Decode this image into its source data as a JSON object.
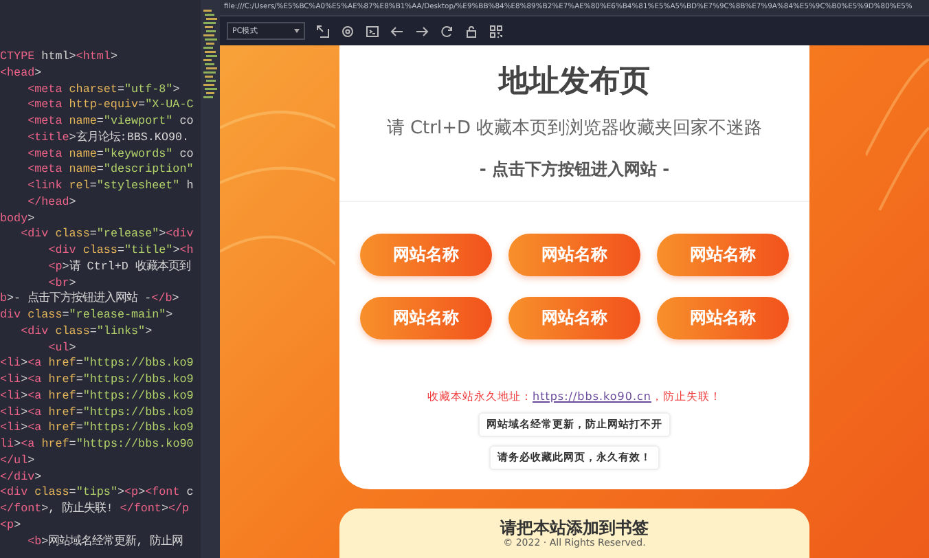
{
  "code_editor": {
    "lines": [
      "CTYPE html><html>",
      "<head>",
      "    <meta charset=\"utf-8\">",
      "    <meta http-equiv=\"X-UA-C",
      "    <meta name=\"viewport\" co",
      "    <title>玄月论坛:BBS.KO90.",
      "    <meta name=\"keywords\" co",
      "    <meta name=\"description\"",
      "    <link rel=\"stylesheet\" h",
      "    </head>",
      "body>",
      "   <div class=\"release\"><div",
      "       <div class=\"title\"><h",
      "       <p>请 Ctrl+D 收藏本页到",
      "       <br>",
      "b>- 点击下方按钮进入网站 -</b>",
      "div class=\"release-main\">",
      "   <div class=\"links\">",
      "       <ul>",
      "<li><a href=\"https://bbs.ko9",
      "<li><a href=\"https://bbs.ko9",
      "<li><a href=\"https://bbs.ko9",
      "<li><a href=\"https://bbs.ko9",
      "<li><a href=\"https://bbs.ko9",
      "li><a href=\"https://bbs.ko90",
      "</ul>",
      "</div>",
      "<div class=\"tips\"><p><font c",
      "</font>, 防止失联! </font></p",
      "<p>",
      "    <b>网站域名经常更新, 防止网"
    ]
  },
  "browser": {
    "address": "file:///C:/Users/%E5%BC%A0%E5%AE%87%E8%B1%AA/Desktop/%E9%BB%84%E8%89%B2%E7%AE%80%E6%B4%81%E5%A5%BD%E7%9C%8B%E7%9A%84%E5%9C%B0%E5%9D%80%E5%",
    "mode": "PC模式"
  },
  "page": {
    "title": "地址发布页",
    "subtitle": "请 Ctrl+D 收藏本页到浏览器收藏夹回家不迷路",
    "prompt": "- 点击下方按钮进入网站 -",
    "links": [
      "网站名称",
      "网站名称",
      "网站名称",
      "网站名称",
      "网站名称",
      "网站名称"
    ],
    "notice": {
      "before": "收藏本站永久地址：",
      "link": "https://bbs.ko90.cn",
      "after": "，防止失联！"
    },
    "tips": [
      "网站域名经常更新，防止网站打不开",
      "请务必收藏此网页，永久有效！"
    ],
    "footer": {
      "title": "请把本站添加到书签",
      "copyright": "© 2022 · All Rights Reserved."
    }
  }
}
